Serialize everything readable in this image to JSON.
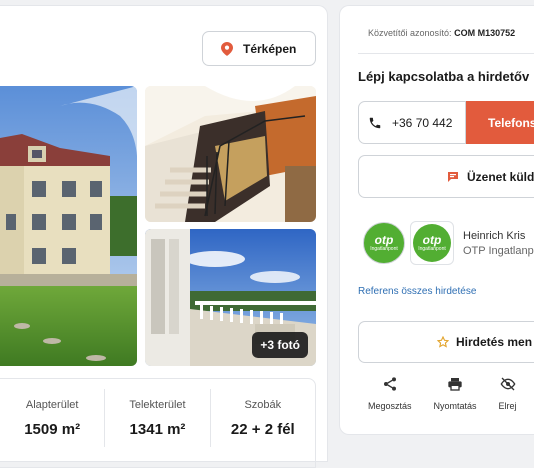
{
  "gallery": {
    "map_button_label": "Térképen",
    "more_photos": "+3 fotó"
  },
  "stats": [
    {
      "label": "Alapterület",
      "value": "1509 m²"
    },
    {
      "label": "Telekterület",
      "value": "1341 m²"
    },
    {
      "label": "Szobák",
      "value": "22 + 2 fél"
    }
  ],
  "contact": {
    "agency_id_label": "Közvetítői azonosító:",
    "agency_id_value": "COM M130752",
    "title": "Lépj kapcsolatba a hirdetőv",
    "phone": "+36 70 442",
    "call_label": "Telefons",
    "message_label": "Üzenet küld",
    "logo_text": "otp",
    "logo_sub": "Ingatlanpont",
    "agent_name": "Heinrich Kris",
    "agent_company": "OTP Ingatlanp",
    "ref_link": "Referens összes hirdetése",
    "ad_menu_label": "Hirdetés men"
  },
  "actions": [
    {
      "label": "Megosztás",
      "icon": "share-icon"
    },
    {
      "label": "Nyomtatás",
      "icon": "print-icon"
    },
    {
      "label": "Elrej",
      "icon": "hide-icon"
    }
  ],
  "colors": {
    "accent": "#e25b3d",
    "link": "#2f6fb3",
    "otp_green": "#52ae32",
    "star": "#e2a32a"
  }
}
